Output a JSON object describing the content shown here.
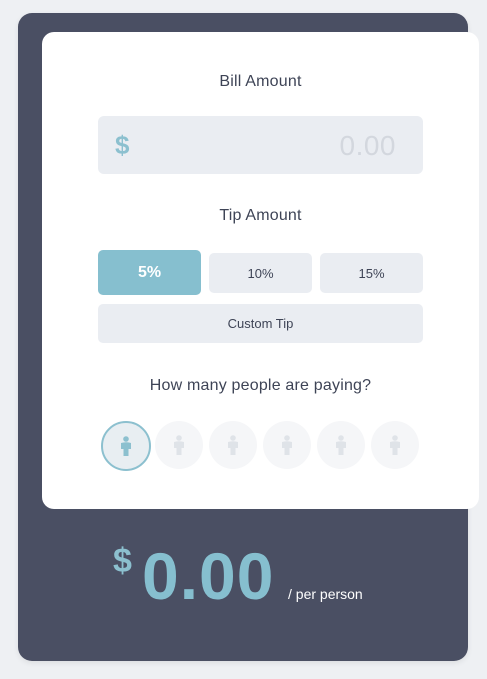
{
  "bill": {
    "title": "Bill Amount",
    "currency_symbol": "$",
    "placeholder": "0.00"
  },
  "tip": {
    "title": "Tip Amount",
    "options": [
      "5%",
      "10%",
      "15%"
    ],
    "selected": "5%",
    "custom_label": "Custom Tip"
  },
  "people": {
    "title": "How many people are paying?",
    "count_options": 6,
    "selected": 1
  },
  "result": {
    "currency_symbol": "$",
    "amount": "0.00",
    "suffix": "/ per person"
  },
  "colors": {
    "accent": "#86bfcf",
    "panel": "#4a4f63",
    "input_bg": "#eaedf2"
  },
  "icons": {
    "person": "person-icon"
  }
}
